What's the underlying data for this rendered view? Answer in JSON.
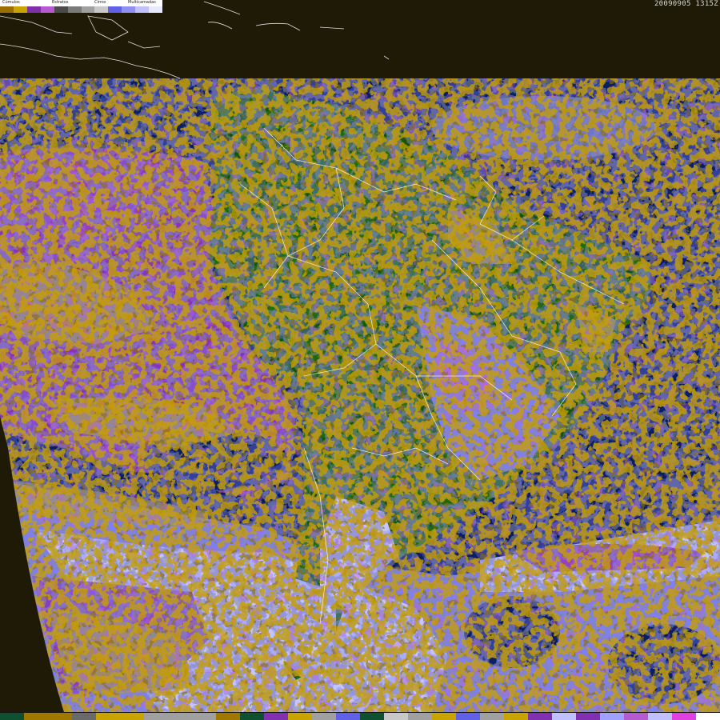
{
  "timestamp": "20090905  1315Z",
  "legend": {
    "labels": [
      "Cúmulos",
      "Estratos",
      "Cirros",
      "Multicamadas"
    ],
    "swatches": [
      "#9a6e00",
      "#c9a400",
      "#7d30a8",
      "#b65ad0",
      "#4a4a4a",
      "#7a7a7a",
      "#a0a0a0",
      "#c8c8c8",
      "#6060e8",
      "#9090f0",
      "#c0c0ff",
      "#e8e8ff"
    ]
  },
  "bottom_scale": [
    "#0e5030",
    "#a07800",
    "#a07800",
    "#6a6a6a",
    "#c9a400",
    "#c9a400",
    "#a0a0a0",
    "#a0a0a0",
    "#a0a0a0",
    "#a07800",
    "#0e5030",
    "#8030b0",
    "#c9a400",
    "#a0a0a0",
    "#6060e8",
    "#0e5030",
    "#c8c8c8",
    "#a0a0a0",
    "#c9a400",
    "#6060e8",
    "#a0a0a0",
    "#c9a400",
    "#8030b0",
    "#c0c0ff",
    "#8030b0",
    "#a0a0ff",
    "#b65ad0",
    "#c0c0ff",
    "#e040e0",
    "#ffffff"
  ],
  "colors": {
    "background": "#1e1a06",
    "ocean": "#0a1e66",
    "land": "#1f6a12",
    "land_dark": "#17520d",
    "cumulus": "#c9a000",
    "cumulus_dark": "#8e6e00",
    "stratus": "#8a32b8",
    "stratus_light": "#b054d4",
    "cirrus_gray": "#8a8a9a",
    "multilayer": "#7f7ff2",
    "multilayer_light": "#c4c4ff",
    "boundary": "#ffffff"
  }
}
